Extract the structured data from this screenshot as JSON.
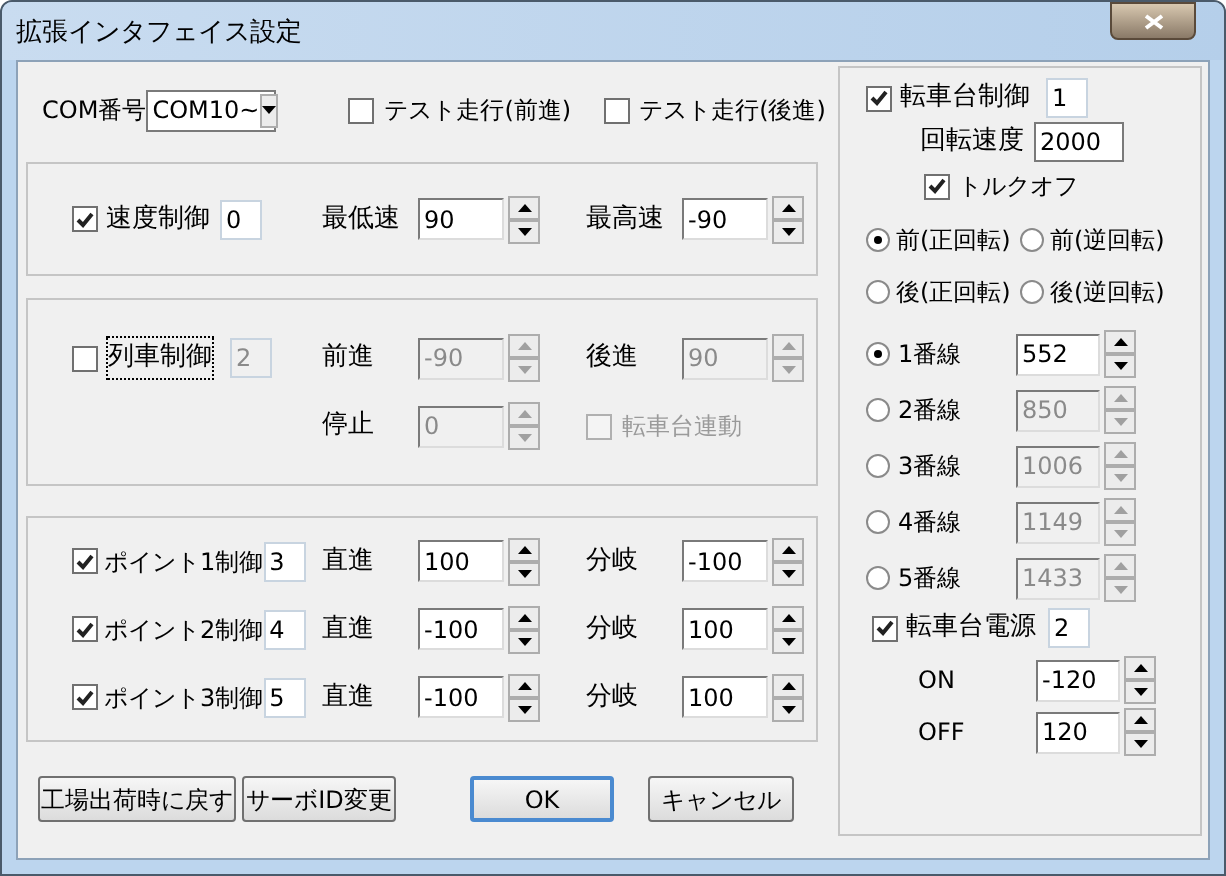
{
  "window": {
    "title": "拡張インタフェイス設定"
  },
  "com": {
    "label": "COM番号",
    "value": "COM10~"
  },
  "test_runs": [
    {
      "label": "テスト走行(前進)",
      "checked": false
    },
    {
      "label": "テスト走行(後進)",
      "checked": false
    }
  ],
  "speed_control": {
    "label": "速度制御",
    "checked": true,
    "id": "0",
    "fields": [
      {
        "label": "最低速",
        "value": "90"
      },
      {
        "label": "最高速",
        "value": "-90"
      }
    ]
  },
  "train_control": {
    "label": "列車制御",
    "checked": false,
    "focused": true,
    "id": "2",
    "disabled": true,
    "fields": [
      {
        "label": "前進",
        "value": "-90"
      },
      {
        "label": "後進",
        "value": "90"
      },
      {
        "label": "停止",
        "value": "0"
      }
    ],
    "link": {
      "label": "転車台連動",
      "checked": false
    }
  },
  "points": [
    {
      "label": "ポイント1制御",
      "checked": true,
      "id": "3",
      "straight": {
        "label": "直進",
        "value": "100"
      },
      "branch": {
        "label": "分岐",
        "value": "-100"
      }
    },
    {
      "label": "ポイント2制御",
      "checked": true,
      "id": "4",
      "straight": {
        "label": "直進",
        "value": "-100"
      },
      "branch": {
        "label": "分岐",
        "value": "100"
      }
    },
    {
      "label": "ポイント3制御",
      "checked": true,
      "id": "5",
      "straight": {
        "label": "直進",
        "value": "-100"
      },
      "branch": {
        "label": "分岐",
        "value": "100"
      }
    }
  ],
  "buttons": [
    {
      "label": "工場出荷時に戻す",
      "default": false
    },
    {
      "label": "サーボID変更",
      "default": false
    },
    {
      "label": "OK",
      "default": true
    },
    {
      "label": "キャンセル",
      "default": false
    }
  ],
  "turntable": {
    "label": "転車台制御",
    "checked": true,
    "id": "1",
    "speed_label": "回転速度",
    "speed": "2000",
    "torque_off": {
      "label": "トルクオフ",
      "checked": true
    },
    "directions": [
      {
        "label": "前(正回転)",
        "selected": true
      },
      {
        "label": "前(逆回転)",
        "selected": false
      },
      {
        "label": "後(正回転)",
        "selected": false
      },
      {
        "label": "後(逆回転)",
        "selected": false
      }
    ],
    "tracks": [
      {
        "label": "1番線",
        "value": "552",
        "selected": true,
        "disabled": false
      },
      {
        "label": "2番線",
        "value": "850",
        "selected": false,
        "disabled": true
      },
      {
        "label": "3番線",
        "value": "1006",
        "selected": false,
        "disabled": true
      },
      {
        "label": "4番線",
        "value": "1149",
        "selected": false,
        "disabled": true
      },
      {
        "label": "5番線",
        "value": "1433",
        "selected": false,
        "disabled": true
      }
    ],
    "power": {
      "label": "転車台電源",
      "checked": true,
      "id": "2",
      "settings": [
        {
          "label": "ON",
          "value": "-120"
        },
        {
          "label": "OFF",
          "value": "120"
        }
      ]
    }
  }
}
